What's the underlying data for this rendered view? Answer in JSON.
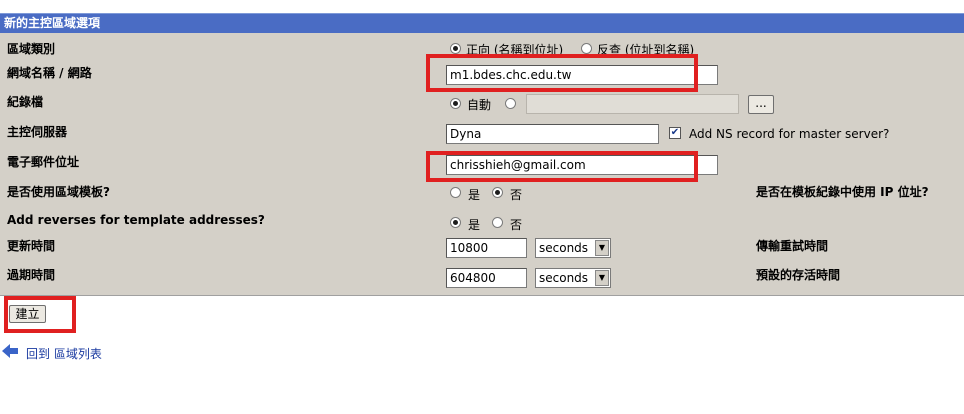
{
  "header": {
    "title": "新的主控區域選項"
  },
  "form": {
    "zone_type": {
      "label": "區域類別",
      "options": [
        "正向 (名稱到位址)",
        "反查 (位址到名稱)"
      ],
      "selected": 0
    },
    "domain": {
      "label": "網域名稱 / 網路",
      "value": "m1.bdes.chc.edu.tw"
    },
    "records_file": {
      "label": "紀錄檔",
      "auto_label": "自動",
      "browse_label": "..."
    },
    "master_server": {
      "label": "主控伺服器",
      "value": "Dyna",
      "ns_checkbox_label": "Add NS record for master server?",
      "ns_checked": true
    },
    "email": {
      "label": "電子郵件位址",
      "value": "chrisshieh@gmail.com"
    },
    "use_template": {
      "label": "是否使用區域模板?",
      "yes": "是",
      "no": "否",
      "selected": "no"
    },
    "template_ip": {
      "label": "是否在模板紀錄中使用 IP 位址?"
    },
    "add_reverses": {
      "label": "Add reverses for template addresses?",
      "yes": "是",
      "no": "否",
      "selected": "yes"
    },
    "refresh": {
      "label": "更新時間",
      "value": "10800",
      "unit": "seconds"
    },
    "retry": {
      "label": "傳輸重試時間"
    },
    "expire": {
      "label": "過期時間",
      "value": "604800",
      "unit": "seconds"
    },
    "ttl": {
      "label": "預設的存活時間"
    }
  },
  "actions": {
    "create_label": "建立"
  },
  "nav": {
    "back_label": "回到 區域列表"
  },
  "colors": {
    "header_bg": "#4a6cc4",
    "panel_bg": "#d4d0c8",
    "highlight": "#e02020",
    "link": "#1a3aa0"
  }
}
